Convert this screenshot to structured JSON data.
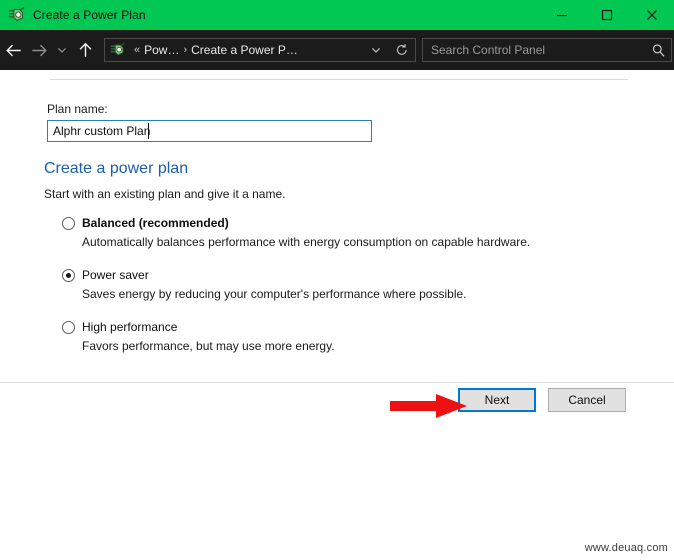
{
  "window": {
    "titlebar": {
      "title": "Create a Power Plan",
      "icon": "power-plan-icon",
      "accent_color": "#00c853",
      "controls": [
        {
          "name": "minimize",
          "glyph": "minimize-icon"
        },
        {
          "name": "maximize",
          "glyph": "maximize-icon"
        },
        {
          "name": "close",
          "glyph": "close-icon"
        }
      ]
    },
    "navbar": {
      "background_color": "#1b1b1b",
      "back": "back-arrow-icon",
      "forward": "forward-arrow-icon",
      "recent": "chevron-down-icon",
      "up": "up-arrow-icon",
      "breadcrumb": {
        "icon": "power-plan-icon",
        "overflow": "«",
        "separator": "›",
        "items": [
          {
            "label": "Pow…"
          },
          {
            "label": "Create a Power P…"
          }
        ],
        "dropdown": "chevron-down-icon",
        "refresh": "refresh-icon"
      },
      "search": {
        "placeholder": "Search Control Panel",
        "value": "",
        "icon": "search-icon"
      }
    },
    "content": {
      "title": "Create a power plan",
      "title_color": "#1d5fa8",
      "subtitle": "Start with an existing plan and give it a name.",
      "options": [
        {
          "label": "Balanced (recommended)",
          "description": "Automatically balances performance with energy consumption on capable hardware.",
          "selected": false,
          "bold": true
        },
        {
          "label": "Power saver",
          "description": "Saves energy by reducing your computer's performance where possible.",
          "selected": true,
          "bold": false
        },
        {
          "label": "High performance",
          "description": "Favors performance, but may use more energy.",
          "selected": false,
          "bold": false
        }
      ],
      "plan_name": {
        "label": "Plan name:",
        "value": "Alphr custom Plan",
        "placeholder": "",
        "focused": true
      }
    },
    "footer": {
      "next_label": "Next",
      "cancel_label": "Cancel",
      "focus_color": "#0078d7"
    }
  },
  "annotation": {
    "arrow": "red-arrow-pointing-right",
    "arrow_color": "#ee1111"
  },
  "watermark": "www.deuaq.com"
}
